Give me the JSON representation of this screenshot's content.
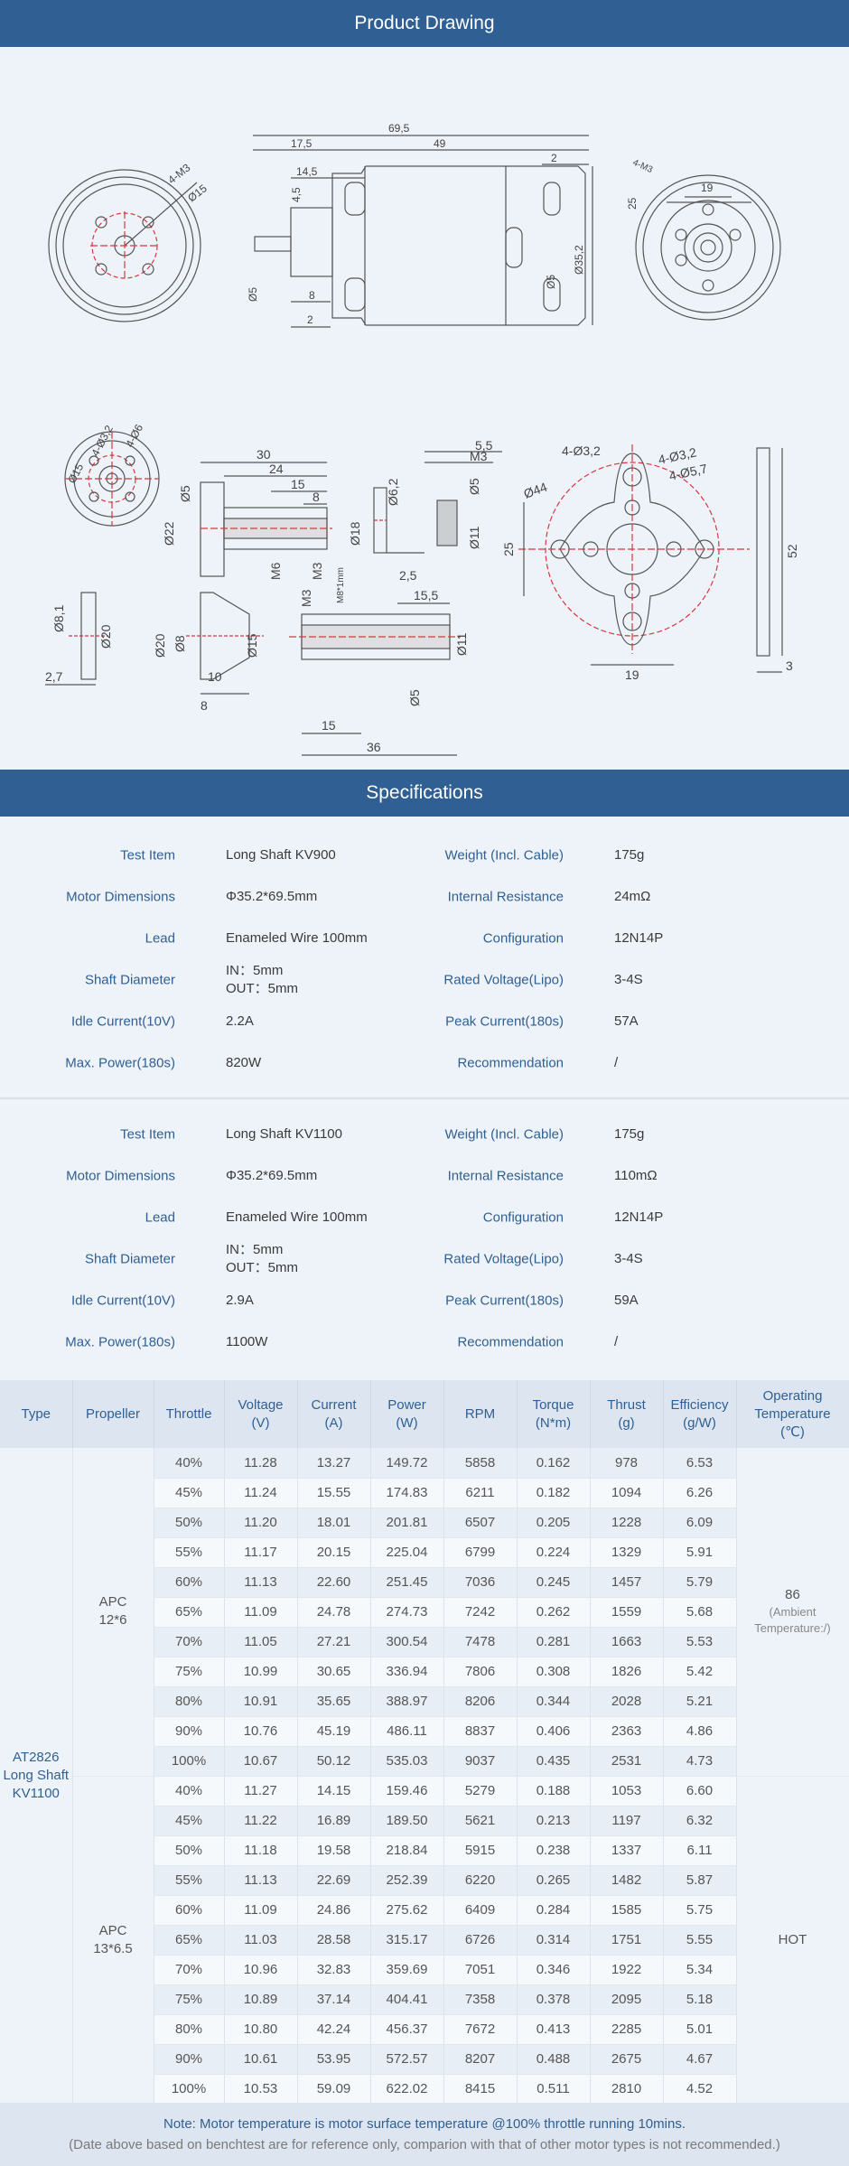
{
  "sections": {
    "drawing_title": "Product Drawing",
    "specs_title": "Specifications"
  },
  "drawing_dims": {
    "d1": "69,5",
    "d2": "17,5",
    "d3": "49",
    "d4": "14,5",
    "d5": "4,5",
    "d6": "2",
    "d7": "8",
    "d8": "2",
    "d9": "Ø5",
    "d10": "Ø5",
    "d11": "Ø35,2",
    "d12": "25",
    "d13": "19",
    "d14": "4-M3",
    "d15": "4-M3",
    "d16": "Ø15",
    "d17": "Ø15",
    "d18": "4-Ø3,2",
    "d19": "4-Ø6",
    "d20": "30",
    "d21": "24",
    "d22": "15",
    "d23": "8",
    "d24": "Ø5",
    "d25": "Ø22",
    "d26": "M6",
    "d27": "M3",
    "d28": "Ø6,2",
    "d29": "Ø18",
    "d30": "2,5",
    "d31": "5,5",
    "d32": "M3",
    "d33": "Ø5",
    "d34": "Ø11",
    "d35": "4-Ø3,2",
    "d36": "4-Ø3,2",
    "d37": "4-Ø5,7",
    "d38": "Ø44",
    "d39": "25",
    "d40": "19",
    "d41": "52",
    "d42": "3",
    "d43": "Ø8,1",
    "d44": "Ø20",
    "d45": "2,7",
    "d46": "Ø20",
    "d47": "Ø8",
    "d48": "Ø15",
    "d49": "8",
    "d50": "10",
    "d51": "M3",
    "d52": "M8*1mm",
    "d53": "15,5",
    "d54": "Ø11",
    "d55": "Ø5",
    "d56": "15",
    "d57": "36"
  },
  "spec_groups": [
    {
      "rows": [
        {
          "l1": "Test Item",
          "v1": "Long Shaft KV900",
          "l2": "Weight (Incl. Cable)",
          "v2": "175g"
        },
        {
          "l1": "Motor Dimensions",
          "v1": "Φ35.2*69.5mm",
          "l2": "Internal Resistance",
          "v2": "24mΩ"
        },
        {
          "l1": "Lead",
          "v1": "Enameled Wire 100mm",
          "l2": "Configuration",
          "v2": "12N14P"
        },
        {
          "l1": "Shaft Diameter",
          "v1": "IN：5mm",
          "v1b": "OUT：5mm",
          "l2": "Rated Voltage(Lipo)",
          "v2": "3-4S"
        },
        {
          "l1": "Idle Current(10V)",
          "v1": "2.2A",
          "l2": "Peak Current(180s)",
          "v2": "57A"
        },
        {
          "l1": "Max. Power(180s)",
          "v1": "820W",
          "l2": "Recommendation",
          "v2": "/"
        }
      ]
    },
    {
      "rows": [
        {
          "l1": "Test Item",
          "v1": "Long Shaft KV1100",
          "l2": "Weight (Incl. Cable)",
          "v2": "175g"
        },
        {
          "l1": "Motor Dimensions",
          "v1": "Φ35.2*69.5mm",
          "l2": "Internal Resistance",
          "v2": "110mΩ"
        },
        {
          "l1": "Lead",
          "v1": "Enameled Wire 100mm",
          "l2": "Configuration",
          "v2": "12N14P"
        },
        {
          "l1": "Shaft Diameter",
          "v1": "IN：5mm",
          "v1b": "OUT：5mm",
          "l2": "Rated Voltage(Lipo)",
          "v2": "3-4S"
        },
        {
          "l1": "Idle Current(10V)",
          "v1": "2.9A",
          "l2": "Peak Current(180s)",
          "v2": "59A"
        },
        {
          "l1": "Max. Power(180s)",
          "v1": "1100W",
          "l2": "Recommendation",
          "v2": "/"
        }
      ]
    }
  ],
  "perf": {
    "headers": [
      {
        "line1": "Type",
        "line2": ""
      },
      {
        "line1": "Propeller",
        "line2": ""
      },
      {
        "line1": "Throttle",
        "line2": ""
      },
      {
        "line1": "Voltage",
        "line2": "(V)"
      },
      {
        "line1": "Current",
        "line2": "(A)"
      },
      {
        "line1": "Power",
        "line2": "(W)"
      },
      {
        "line1": "RPM",
        "line2": ""
      },
      {
        "line1": "Torque",
        "line2": "(N*m)"
      },
      {
        "line1": "Thrust",
        "line2": "(g)"
      },
      {
        "line1": "Efficiency",
        "line2": "(g/W)"
      },
      {
        "line1": "Operating",
        "line2": "Temperature",
        "line3": "(℃)"
      }
    ],
    "type": {
      "line1": "AT2826",
      "line2": "Long Shaft",
      "line3": "KV1100"
    },
    "groups": [
      {
        "propeller": {
          "line1": "APC",
          "line2": "12*6"
        },
        "temp": {
          "line1": "86",
          "line2": "(Ambient",
          "line3": "Temperature:/)"
        },
        "rows": [
          [
            "40%",
            "11.28",
            "13.27",
            "149.72",
            "5858",
            "0.162",
            "978",
            "6.53"
          ],
          [
            "45%",
            "11.24",
            "15.55",
            "174.83",
            "6211",
            "0.182",
            "1094",
            "6.26"
          ],
          [
            "50%",
            "11.20",
            "18.01",
            "201.81",
            "6507",
            "0.205",
            "1228",
            "6.09"
          ],
          [
            "55%",
            "11.17",
            "20.15",
            "225.04",
            "6799",
            "0.224",
            "1329",
            "5.91"
          ],
          [
            "60%",
            "11.13",
            "22.60",
            "251.45",
            "7036",
            "0.245",
            "1457",
            "5.79"
          ],
          [
            "65%",
            "11.09",
            "24.78",
            "274.73",
            "7242",
            "0.262",
            "1559",
            "5.68"
          ],
          [
            "70%",
            "11.05",
            "27.21",
            "300.54",
            "7478",
            "0.281",
            "1663",
            "5.53"
          ],
          [
            "75%",
            "10.99",
            "30.65",
            "336.94",
            "7806",
            "0.308",
            "1826",
            "5.42"
          ],
          [
            "80%",
            "10.91",
            "35.65",
            "388.97",
            "8206",
            "0.344",
            "2028",
            "5.21"
          ],
          [
            "90%",
            "10.76",
            "45.19",
            "486.11",
            "8837",
            "0.406",
            "2363",
            "4.86"
          ],
          [
            "100%",
            "10.67",
            "50.12",
            "535.03",
            "9037",
            "0.435",
            "2531",
            "4.73"
          ]
        ]
      },
      {
        "propeller": {
          "line1": "APC",
          "line2": "13*6.5"
        },
        "temp": {
          "line1": "HOT",
          "line2": "",
          "line3": ""
        },
        "rows": [
          [
            "40%",
            "11.27",
            "14.15",
            "159.46",
            "5279",
            "0.188",
            "1053",
            "6.60"
          ],
          [
            "45%",
            "11.22",
            "16.89",
            "189.50",
            "5621",
            "0.213",
            "1197",
            "6.32"
          ],
          [
            "50%",
            "11.18",
            "19.58",
            "218.84",
            "5915",
            "0.238",
            "1337",
            "6.11"
          ],
          [
            "55%",
            "11.13",
            "22.69",
            "252.39",
            "6220",
            "0.265",
            "1482",
            "5.87"
          ],
          [
            "60%",
            "11.09",
            "24.86",
            "275.62",
            "6409",
            "0.284",
            "1585",
            "5.75"
          ],
          [
            "65%",
            "11.03",
            "28.58",
            "315.17",
            "6726",
            "0.314",
            "1751",
            "5.55"
          ],
          [
            "70%",
            "10.96",
            "32.83",
            "359.69",
            "7051",
            "0.346",
            "1922",
            "5.34"
          ],
          [
            "75%",
            "10.89",
            "37.14",
            "404.41",
            "7358",
            "0.378",
            "2095",
            "5.18"
          ],
          [
            "80%",
            "10.80",
            "42.24",
            "456.37",
            "7672",
            "0.413",
            "2285",
            "5.01"
          ],
          [
            "90%",
            "10.61",
            "53.95",
            "572.57",
            "8207",
            "0.488",
            "2675",
            "4.67"
          ],
          [
            "100%",
            "10.53",
            "59.09",
            "622.02",
            "8415",
            "0.511",
            "2810",
            "4.52"
          ]
        ]
      }
    ]
  },
  "notes": {
    "line1": "Note: Motor temperature is motor surface temperature @100% throttle running 10mins.",
    "line2": "(Date above based on benchtest are for reference only, comparion with that of other motor types is not recommended.)"
  },
  "colors": {
    "header": "#2f5f93",
    "background": "#eef3f9",
    "accent_red": "#d9363e"
  }
}
